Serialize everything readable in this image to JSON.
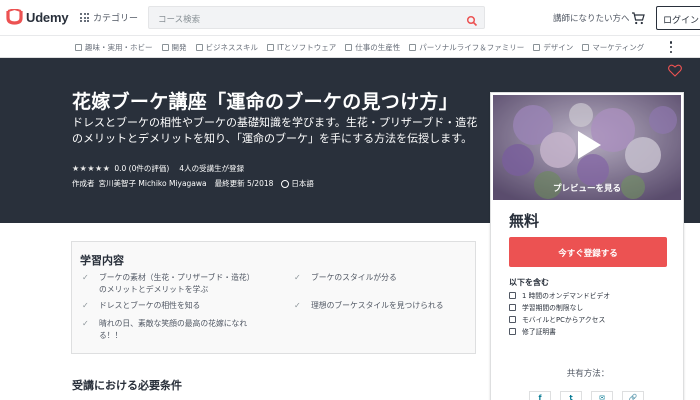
{
  "header": {
    "logo_text": "Udemy",
    "categories_label": "カテゴリー",
    "search_placeholder": "コース検索",
    "instructor_link": "講師になりたい方へ",
    "login_label": "ログイン"
  },
  "subnav": {
    "items": [
      {
        "label": "趣味・実用・ホビー",
        "icon": "star-icon"
      },
      {
        "label": "開発",
        "icon": "code-icon"
      },
      {
        "label": "ビジネススキル",
        "icon": "chart-icon"
      },
      {
        "label": "ITとソフトウェア",
        "icon": "monitor-icon"
      },
      {
        "label": "仕事の生産性",
        "icon": "briefcase-icon"
      },
      {
        "label": "パーソナルライフ＆ファミリー",
        "icon": "person-icon"
      },
      {
        "label": "デザイン",
        "icon": "pen-icon"
      },
      {
        "label": "マーケティング",
        "icon": "megaphone-icon"
      }
    ]
  },
  "course": {
    "title": "花嫁ブーケ講座「運命のブーケの見つけ方」",
    "subtitle": "ドレスとブーケの相性やブーケの基礎知識を学びます。生花・プリザーブド・造花のメリットとデメリットを知り、「運命のブーケ」を手にする方法を伝授します。",
    "stars": "★★★★★",
    "rating_text": "0.0 (0件の評価)",
    "enrolled_text": "4人の受講生が登録",
    "author_prefix": "作成者",
    "author": "宮川美智子 Michiko Miyagawa",
    "updated": "最終更新 5/2018",
    "language": "日本語"
  },
  "sidebar": {
    "preview_label": "プレビューを見る",
    "price": "無料",
    "enroll_label": "今すぐ登録する",
    "includes_title": "以下を含む",
    "includes": [
      {
        "label": "1 時間のオンデマンドビデオ",
        "icon": "video-icon"
      },
      {
        "label": "学習期間の制限なし",
        "icon": "infinity-icon"
      },
      {
        "label": "モバイルとPCからアクセス",
        "icon": "mobile-icon"
      },
      {
        "label": "修了証明書",
        "icon": "certificate-icon"
      }
    ],
    "share_label": "共有方法：",
    "share_buttons": [
      "f",
      "t",
      "✉",
      "🔗"
    ]
  },
  "learn": {
    "title": "学習内容",
    "items": [
      "ブーケの素材（生花・プリザーブド・造花）のメリットとデメリットを学ぶ",
      "ブーケのスタイルが分る",
      "ドレスとブーケの相性を知る",
      "理想のブーケスタイルを見つけられる",
      "晴れの日、素敵な笑顔の最高の花嫁になれる！！"
    ]
  },
  "requirements": {
    "title": "受講における必要条件"
  },
  "colors": {
    "accent": "#ec5252",
    "hero_bg": "#29303b",
    "brand": "#ec5252"
  }
}
